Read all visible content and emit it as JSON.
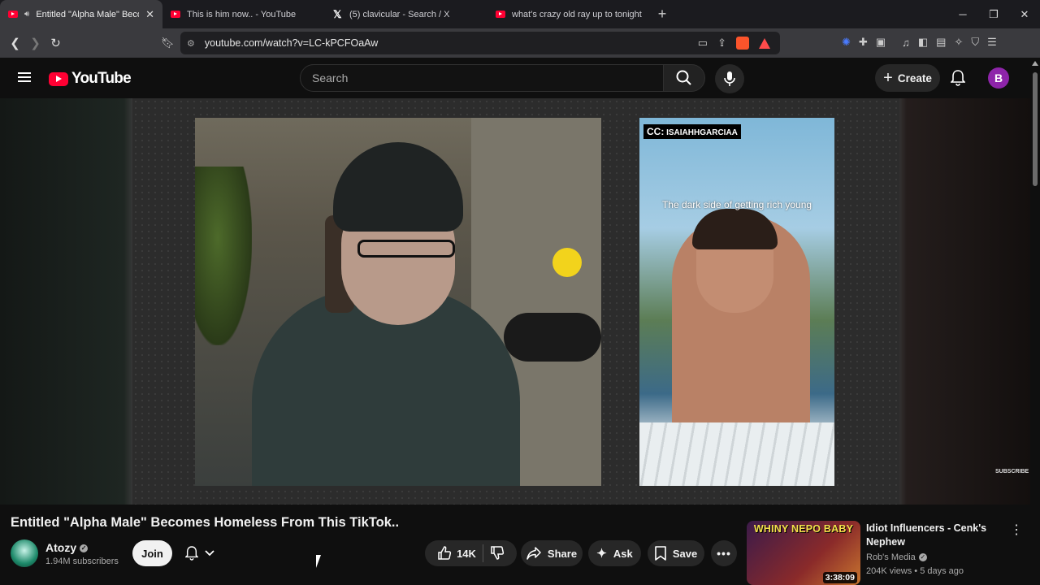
{
  "browser": {
    "tabs": [
      {
        "label": "Entitled \"Alpha Male\" Become",
        "active": true,
        "icon": "youtube-icon",
        "audio": true
      },
      {
        "label": "This is him now.. - YouTube",
        "active": false,
        "icon": "youtube-icon"
      },
      {
        "label": "(5) clavicular - Search / X",
        "active": false,
        "icon": "x-icon"
      },
      {
        "label": "what's crazy old ray up to tonight? (g",
        "active": false,
        "icon": "youtube-icon"
      }
    ],
    "url": "youtube.com/watch?v=LC-kPCFOaAw",
    "brave_badge": "10"
  },
  "header": {
    "logo_text": "YouTube",
    "search_placeholder": "Search",
    "create_label": "Create",
    "avatar_letter": "B"
  },
  "video": {
    "cc_prefix": "CC:",
    "cc_handle": "ISAIAHHGARCIAA",
    "tiktok_caption": "The dark side of getting rich young",
    "watermark": "SUBSCRIBE",
    "title": "Entitled \"Alpha Male\" Becomes Homeless From This TikTok..",
    "channel": {
      "name": "Atozy",
      "subscribers": "1.94M subscribers",
      "join_label": "Join"
    },
    "actions": {
      "likes": "14K",
      "share": "Share",
      "ask": "Ask",
      "save": "Save"
    }
  },
  "recommendation": {
    "thumb_text": "WHINY NEPO BABY",
    "duration": "3:38:09",
    "title": "Idiot Influencers - Cenk's Nephew",
    "channel": "Rob's Media",
    "meta": "204K views • 5 days ago"
  },
  "colors": {
    "youtube_red": "#ff0033",
    "avatar_purple": "#8e24aa",
    "background": "#0f0f0f"
  }
}
